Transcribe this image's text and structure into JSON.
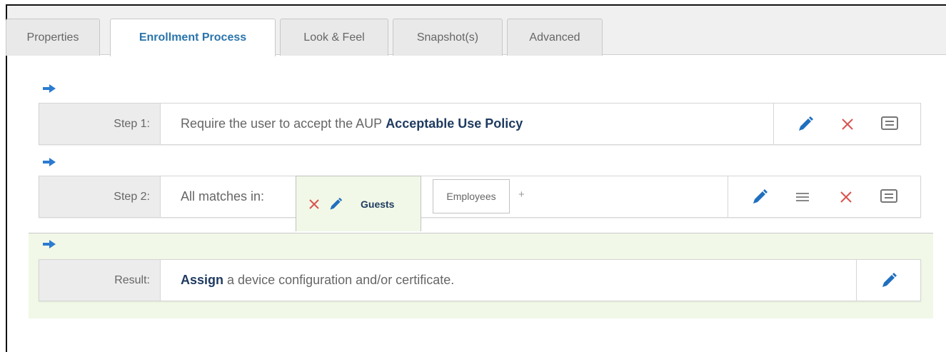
{
  "tabs": [
    {
      "label": "Properties",
      "active": false
    },
    {
      "label": "Enrollment Process",
      "active": true
    },
    {
      "label": "Look & Feel",
      "active": false
    },
    {
      "label": "Snapshot(s)",
      "active": false
    },
    {
      "label": "Advanced",
      "active": false
    }
  ],
  "step1": {
    "label": "Step 1:",
    "text": "Require the user to accept the AUP",
    "bold": "Acceptable Use Policy",
    "actions": [
      "pencil-icon",
      "delete-icon",
      "comment-icon"
    ]
  },
  "step2": {
    "label": "Step 2:",
    "text": "All matches in:",
    "groups": [
      {
        "label": "Guests",
        "selected": true
      },
      {
        "label": "Employees",
        "selected": false
      }
    ],
    "add": "+",
    "actions": [
      "pencil-icon",
      "reorder-icon",
      "delete-icon",
      "comment-icon"
    ]
  },
  "result": {
    "label": "Result:",
    "bold": "Assign",
    "text": "a device configuration and/or certificate.",
    "actions": [
      "pencil-icon"
    ]
  },
  "colors": {
    "accent": "#2a74ab",
    "arrow": "#2b7bd0",
    "delete": "#d9534f",
    "result_bg": "#f1f8e7"
  }
}
